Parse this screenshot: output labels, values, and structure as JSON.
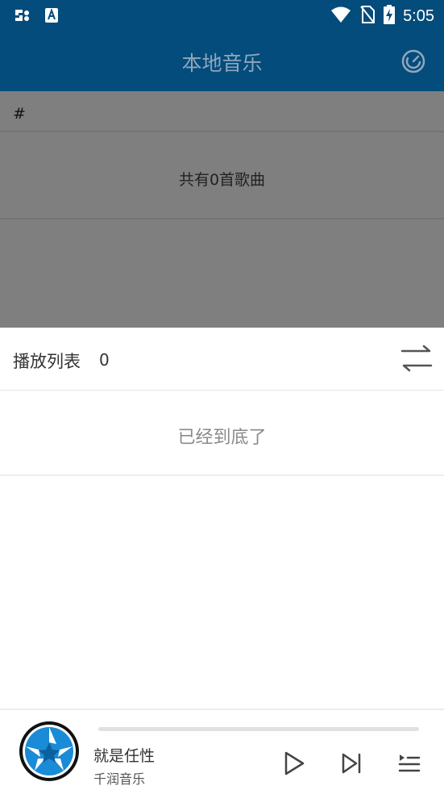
{
  "status_bar": {
    "time": "5:05",
    "left_icons": [
      "app-notification-icon",
      "store-notification-icon"
    ],
    "right_icons": [
      "wifi-icon",
      "no-sim-icon",
      "battery-charging-icon"
    ]
  },
  "app_bar": {
    "title": "本地音乐",
    "action_icon": "gauge-icon"
  },
  "list": {
    "section_letter": "#",
    "count_text": "共有0首歌曲"
  },
  "playlist_sheet": {
    "title": "播放列表",
    "count": "0",
    "shuffle_icon": "shuffle-icon",
    "end_text": "已经到底了"
  },
  "player": {
    "song_title": "就是任性",
    "artist": "千润音乐",
    "progress": 0,
    "controls": [
      "play-icon",
      "next-icon",
      "queue-icon"
    ]
  },
  "colors": {
    "primary": "#034c7b",
    "title_text": "#8fa7bd",
    "dim_overlay": "#7f7f7f",
    "album_blue": "#1a8bd6"
  }
}
